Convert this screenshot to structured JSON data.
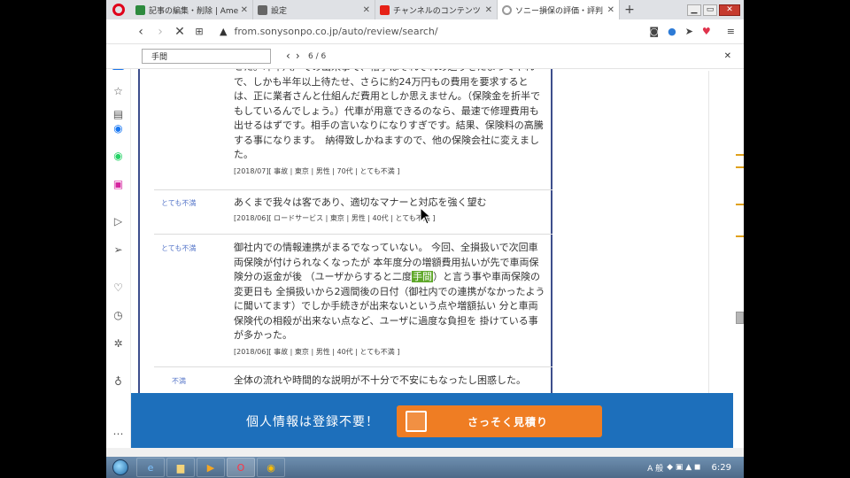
{
  "tabs": [
    {
      "title": "記事の編集・削除 | Ameb",
      "icon_color": "#2d8a3e",
      "active": false
    },
    {
      "title": "設定",
      "icon_color": "#666666",
      "active": false
    },
    {
      "title": "チャンネルのコンテンツ",
      "icon_color": "#e62117",
      "active": false
    },
    {
      "title": "ソニー損保の評価・評判",
      "icon_color": "#999999",
      "active": true
    }
  ],
  "address": {
    "url": "from.sonysonpo.co.jp/auto/review/search/"
  },
  "find": {
    "query": "手間",
    "count": "6 / 6"
  },
  "reviews": [
    {
      "rating": "",
      "body": "せた。昨年八戸での出来事で、相手はそれぞれの巡りをたまってやれで、しかも半年以上待たせ、さらに約24万円もの費用を要求するとは、正に業者さんと仕組んだ費用としか思えません。（保険金を折半でもしているんでしょう。）代車が用意できるのなら、最速で修理費用も出せるはずです。相手の言いなりになりすぎです。結果、保険料の高騰する事になります。　納得致しかねますので、他の保険会社に変えました。",
      "meta": "[2018/07][ 事故 | 東京 | 男性 | 70代 | とても不満 ]"
    },
    {
      "rating": "とても不満",
      "body": "あくまで我々は客であり、適切なマナーと対応を強く望む",
      "meta": "[2018/06][ ロードサービス | 東京 | 男性 | 40代 | とても不満 ]"
    },
    {
      "rating": "とても不満",
      "body_before": "御社内での情報連携がまるでなっていない。 今回、全損扱いで次回車両保険が付けられなくなったが 本年度分の増額費用払いが先で車両保険分の返金が後 （ユーザからすると二度",
      "highlight": "手間",
      "body_after": "）と言う事や車両保険の変更日も 全損扱いから2週間後の日付（御社内での連携がなかったよう に聞いてます）でしか手続きが出来ないという点や増額払い 分と車両保険代の相殺が出来ない点など、ユーザに過度な負担を 掛けている事が多かった。",
      "meta": "[2018/06][ 事故 | 東京 | 男性 | 40代 | とても不満 ]"
    },
    {
      "rating": "不満",
      "body": "全体の流れや時間的な説明が不十分で不安にもなったし困惑した。",
      "meta": ""
    }
  ],
  "banner": {
    "text": "個人情報は登録不要！",
    "cta_label": "さっそく見積り"
  },
  "taskbar": {
    "time": "6:29",
    "ime_label": "A 般"
  },
  "colors": {
    "accent": "#1d6fbb",
    "cta": "#ef7d23",
    "highlight": "#5fa82a",
    "rating": "#5676c9",
    "border": "#3d4e8c"
  }
}
